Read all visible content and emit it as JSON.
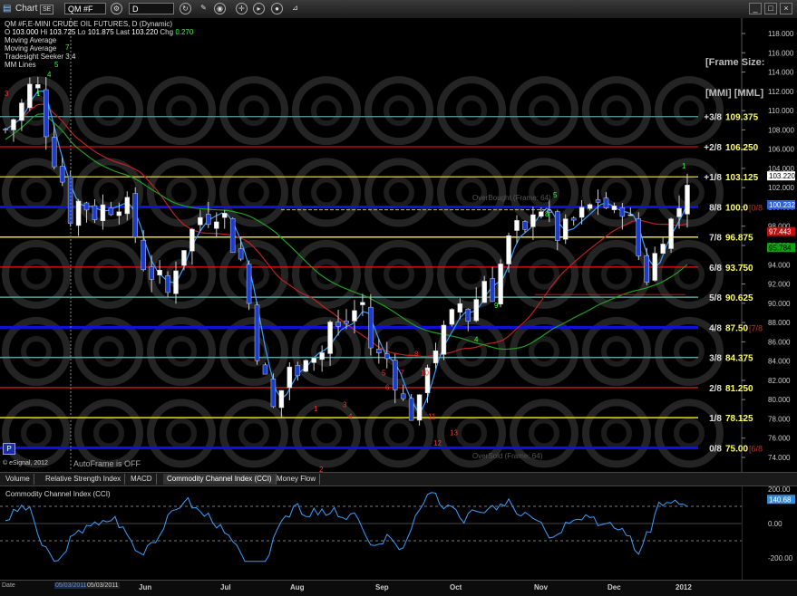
{
  "toolbar": {
    "chart_label": "Chart",
    "chart_badge": "SE",
    "symbol": "QM #F",
    "interval": "D"
  },
  "chart_header": {
    "title": "QM #F,E-MINI CRUDE OIL FUTURES, D (Dynamic)",
    "ohlc": {
      "o_label": "O",
      "o": "103.000",
      "h_label": "Hi",
      "h": "103.725",
      "l_label": "Lo",
      "l": "101.875",
      "last_label": "Last",
      "last": "103.220",
      "chg_label": "Chg",
      "chg": "0.270"
    },
    "studies": [
      "Moving Average",
      "Moving Average",
      "Tradesight Seeker 3.4",
      "MM Lines"
    ]
  },
  "frame_labels": {
    "frame_size": "[Frame Size:",
    "mmi": "[MMI] [MML]"
  },
  "annotations": {
    "autoframe": "AutoFrame is OFF",
    "overbought": "OverBought (Frame: 64)",
    "oversold": "OverSold (Frame: 64)",
    "copyright": "© eSignal, 2012",
    "p_button": "P"
  },
  "murrey_lines": [
    {
      "label": "+3/8",
      "value": "109.375",
      "level": 109.375,
      "color": "#5f9ea0",
      "width": 1.2
    },
    {
      "label": "+2/8",
      "value": "106.250",
      "level": 106.25,
      "color": "#d01010",
      "width": 1.2
    },
    {
      "label": "+1/8",
      "value": "103.125",
      "level": 103.125,
      "color": "#e6e600",
      "width": 1.2
    },
    {
      "label": "8/8",
      "value": "100.0",
      "level": 100.0,
      "color": "#1010e0",
      "width": 3,
      "tag": "[0/8"
    },
    {
      "label": "7/8",
      "value": "96.875",
      "level": 96.875,
      "color": "#e6e600",
      "width": 1.5
    },
    {
      "label": "6/8",
      "value": "93.750",
      "level": 93.75,
      "color": "#d01010",
      "width": 1.5
    },
    {
      "label": "5/8",
      "value": "90.625",
      "level": 90.625,
      "color": "#5f9ea0",
      "width": 1.5
    },
    {
      "label": "4/8",
      "value": "87.50",
      "level": 87.5,
      "color": "#1010e0",
      "width": 3,
      "tag": "[7/8"
    },
    {
      "label": "3/8",
      "value": "84.375",
      "level": 84.375,
      "color": "#5f9ea0",
      "width": 1.5
    },
    {
      "label": "2/8",
      "value": "81.250",
      "level": 81.25,
      "color": "#d01010",
      "width": 1.5
    },
    {
      "label": "1/8",
      "value": "78.125",
      "level": 78.125,
      "color": "#e6e600",
      "width": 1.5
    },
    {
      "label": "0/8",
      "value": "75.00",
      "level": 75.0,
      "color": "#1010e0",
      "width": 3,
      "tag": "[6/8"
    }
  ],
  "price_axis": {
    "ticks": [
      "118.000",
      "116.000",
      "114.000",
      "112.000",
      "110.000",
      "108.000",
      "106.000",
      "104.000",
      "102.000",
      "100.000",
      "98.000",
      "96.000",
      "94.000",
      "92.000",
      "90.000",
      "88.000",
      "86.000",
      "84.000",
      "82.000",
      "80.000",
      "78.000",
      "76.000",
      "74.000"
    ],
    "badges": [
      {
        "text": "103.220",
        "bg": "#ffffff",
        "fg": "#000000",
        "level": 103.22
      },
      {
        "text": "100.232",
        "bg": "#3060e0",
        "fg": "#ffffff",
        "level": 100.232
      },
      {
        "text": "97.443",
        "bg": "#c01010",
        "fg": "#ffffff",
        "level": 97.443
      },
      {
        "text": "95.784",
        "bg": "#10a010",
        "fg": "#000000",
        "level": 95.784
      }
    ]
  },
  "tabs": [
    "Volume",
    "Relative Strength Index",
    "MACD",
    "Commodity Channel Index (CCI)",
    "Money Flow"
  ],
  "active_tab": 3,
  "cci": {
    "title": "Commodity Channel Index (CCI)",
    "ticks": [
      "200.00",
      "0.00",
      "-200.00"
    ],
    "last_badge": "140.68"
  },
  "date_axis": {
    "labels": [
      "Jun",
      "Jul",
      "Aug",
      "Sep",
      "Oct",
      "Nov",
      "Dec",
      "2012"
    ],
    "range_start": "05/03/2011",
    "range_end": "05/03/2011",
    "corner": "Date"
  },
  "chart_data": {
    "type": "candlestick",
    "title": "QM #F,E-MINI CRUDE OIL FUTURES, D (Dynamic)",
    "ylim": [
      73,
      119
    ],
    "series": [
      {
        "name": "QM #F",
        "close_path": [
          [
            0,
            108
          ],
          [
            5,
            110
          ],
          [
            10,
            113
          ],
          [
            13,
            112
          ],
          [
            16,
            106
          ],
          [
            20,
            104
          ],
          [
            24,
            99
          ],
          [
            28,
            101
          ],
          [
            32,
            99
          ],
          [
            36,
            100
          ],
          [
            40,
            100
          ],
          [
            44,
            101
          ],
          [
            48,
            97
          ],
          [
            52,
            93
          ],
          [
            56,
            93
          ],
          [
            60,
            91
          ],
          [
            64,
            95
          ],
          [
            68,
            97
          ],
          [
            72,
            99
          ],
          [
            76,
            99
          ],
          [
            80,
            100
          ],
          [
            84,
            96
          ],
          [
            88,
            94
          ],
          [
            92,
            86
          ],
          [
            96,
            82
          ],
          [
            100,
            78
          ],
          [
            104,
            84
          ],
          [
            108,
            82
          ],
          [
            112,
            86
          ],
          [
            116,
            84
          ],
          [
            120,
            88
          ],
          [
            124,
            87
          ],
          [
            128,
            89
          ],
          [
            132,
            90
          ],
          [
            136,
            84
          ],
          [
            140,
            85
          ],
          [
            144,
            82
          ],
          [
            148,
            79
          ],
          [
            152,
            78
          ],
          [
            156,
            84
          ],
          [
            160,
            86
          ],
          [
            164,
            88
          ],
          [
            168,
            90
          ],
          [
            172,
            88
          ],
          [
            176,
            93
          ],
          [
            180,
            91
          ],
          [
            184,
            95
          ],
          [
            188,
            98
          ],
          [
            192,
            97
          ],
          [
            196,
            101
          ],
          [
            200,
            99
          ],
          [
            204,
            97
          ],
          [
            208,
            98
          ],
          [
            212,
            99
          ],
          [
            216,
            100
          ],
          [
            220,
            101
          ],
          [
            224,
            99
          ],
          [
            228,
            100
          ],
          [
            232,
            98
          ],
          [
            236,
            92
          ],
          [
            240,
            95
          ],
          [
            244,
            98
          ],
          [
            248,
            99
          ],
          [
            252,
            103
          ]
        ]
      }
    ]
  }
}
